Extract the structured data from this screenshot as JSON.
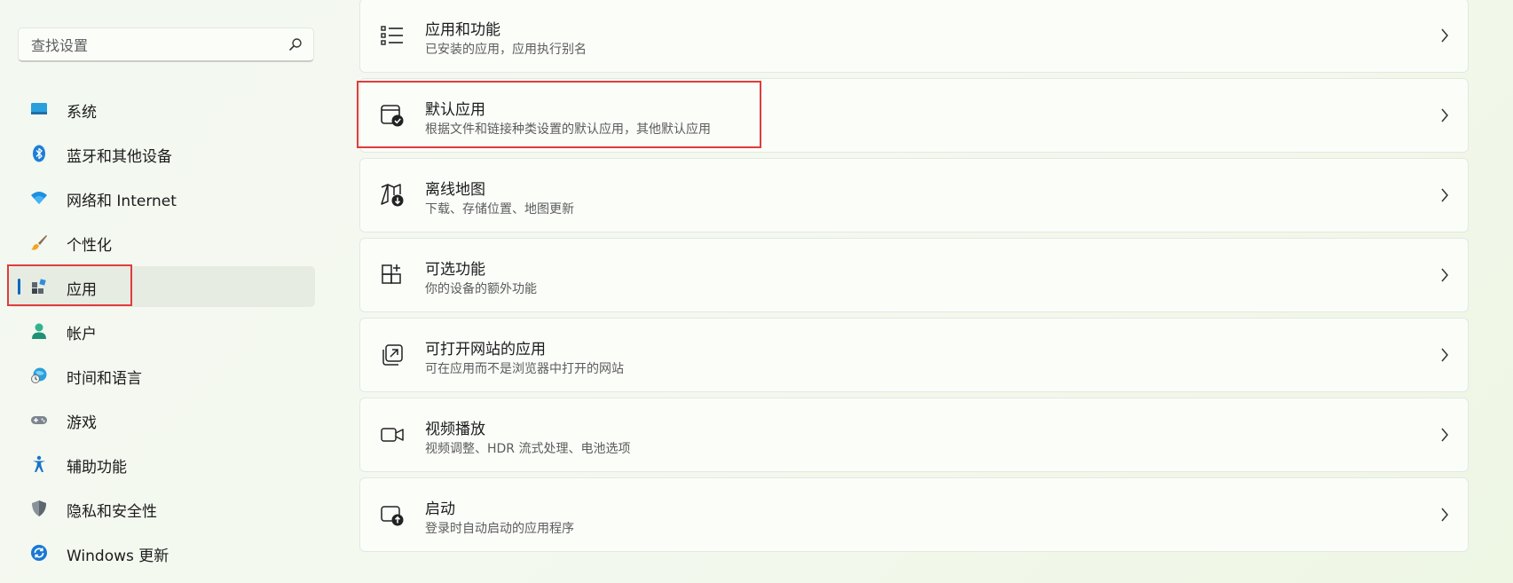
{
  "search": {
    "placeholder": "查找设置",
    "icon": "search-icon"
  },
  "sidebar": {
    "items": [
      {
        "label": "系统",
        "icon": "system-display-icon",
        "selected": false
      },
      {
        "label": "蓝牙和其他设备",
        "icon": "bluetooth-icon",
        "selected": false
      },
      {
        "label": "网络和 Internet",
        "icon": "wifi-icon",
        "selected": false
      },
      {
        "label": "个性化",
        "icon": "paintbrush-icon",
        "selected": false
      },
      {
        "label": "应用",
        "icon": "apps-icon",
        "selected": true
      },
      {
        "label": "帐户",
        "icon": "account-icon",
        "selected": false
      },
      {
        "label": "时间和语言",
        "icon": "time-language-icon",
        "selected": false
      },
      {
        "label": "游戏",
        "icon": "gamepad-icon",
        "selected": false
      },
      {
        "label": "辅助功能",
        "icon": "accessibility-icon",
        "selected": false
      },
      {
        "label": "隐私和安全性",
        "icon": "shield-icon",
        "selected": false
      },
      {
        "label": "Windows 更新",
        "icon": "windows-update-icon",
        "selected": false
      }
    ]
  },
  "main": {
    "cards": [
      {
        "title": "应用和功能",
        "desc": "已安装的应用，应用执行别名",
        "icon": "list-icon"
      },
      {
        "title": "默认应用",
        "desc": "根据文件和链接种类设置的默认应用，其他默认应用",
        "icon": "default-apps-icon"
      },
      {
        "title": "离线地图",
        "desc": "下载、存储位置、地图更新",
        "icon": "offline-map-icon"
      },
      {
        "title": "可选功能",
        "desc": "你的设备的额外功能",
        "icon": "optional-features-icon"
      },
      {
        "title": "可打开网站的应用",
        "desc": "可在应用而不是浏览器中打开的网站",
        "icon": "open-website-icon"
      },
      {
        "title": "视频播放",
        "desc": "视频调整、HDR 流式处理、电池选项",
        "icon": "video-camera-icon"
      },
      {
        "title": "启动",
        "desc": "登录时自动启动的应用程序",
        "icon": "startup-icon"
      }
    ]
  },
  "colors": {
    "accent": "#0067c0",
    "highlight_border": "#e03c3c",
    "card_background": "#fbfdf9"
  }
}
